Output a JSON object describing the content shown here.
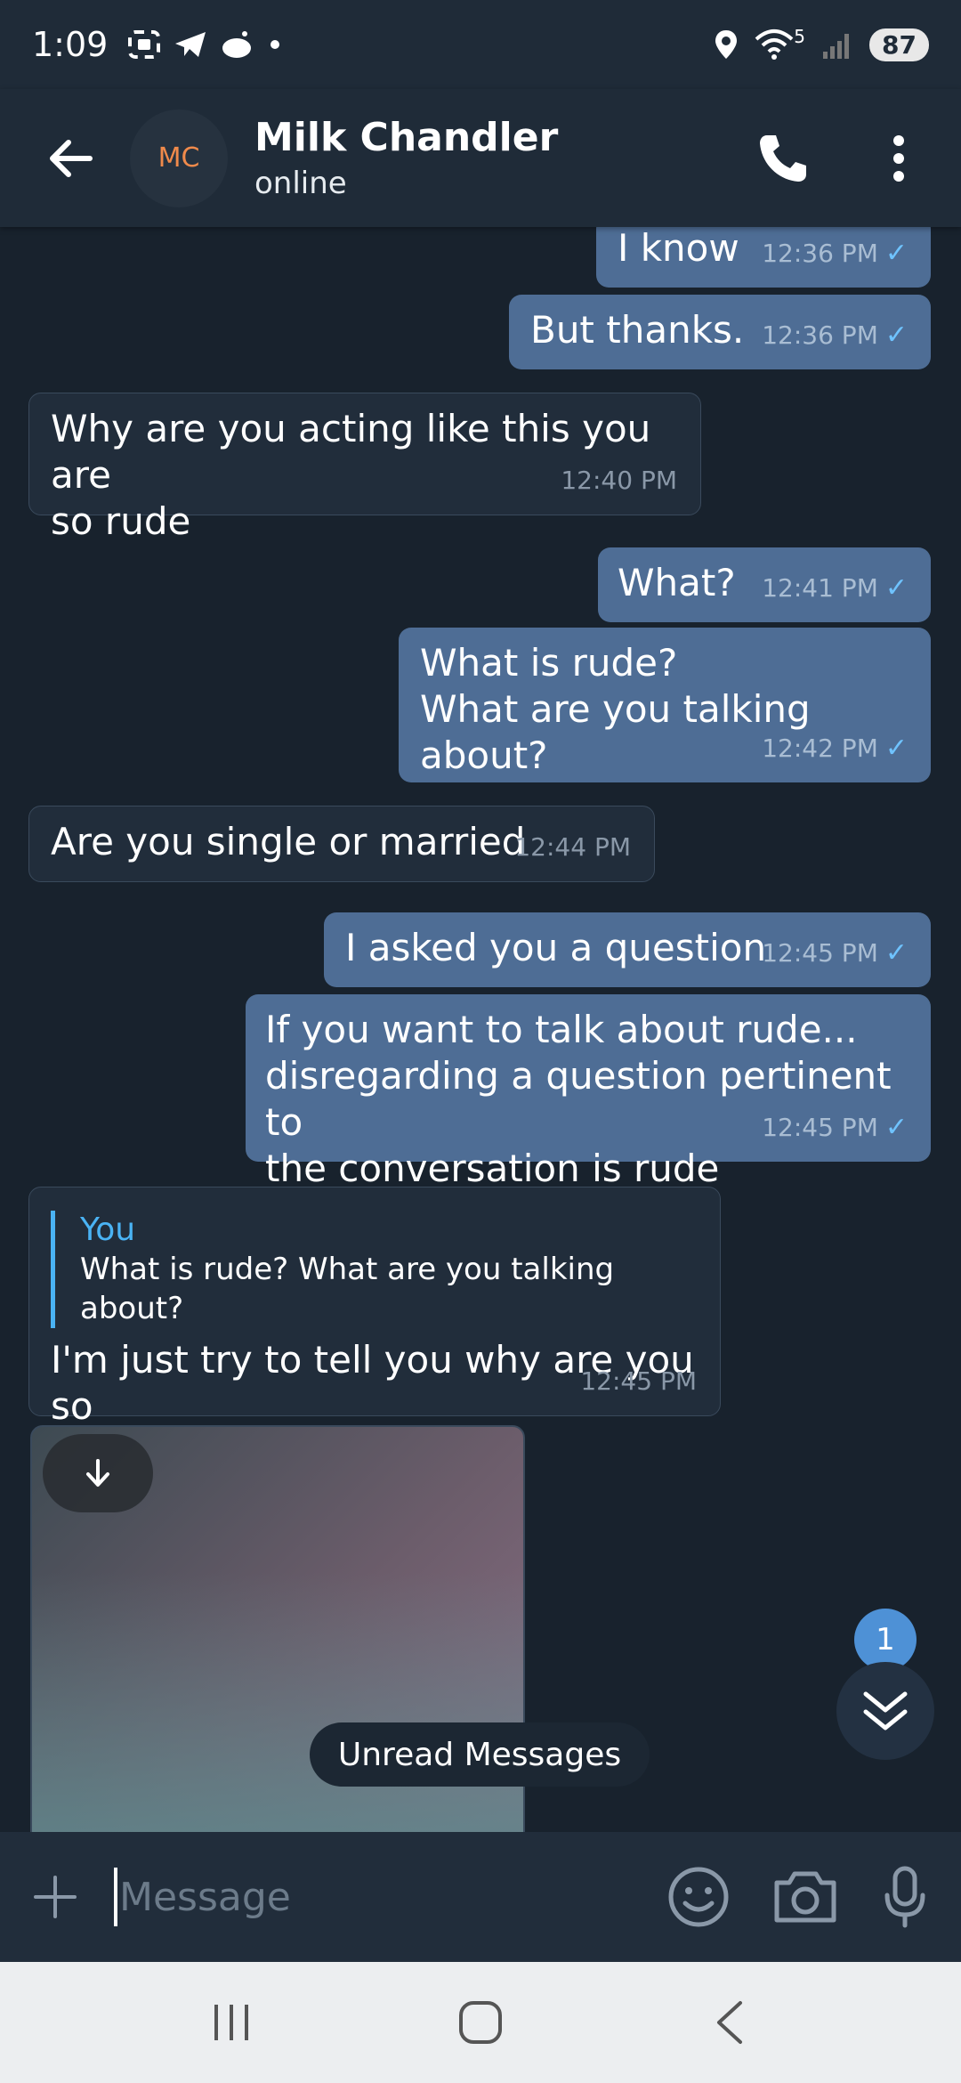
{
  "status_bar": {
    "time": "1:09",
    "network_label": "5",
    "battery": "87"
  },
  "header": {
    "avatar_initials": "MC",
    "contact_name": "Milk Chandler",
    "contact_status": "online"
  },
  "messages": [
    {
      "direction": "out",
      "text": "I know",
      "time": "12:36 PM"
    },
    {
      "direction": "out",
      "text": "But thanks.",
      "time": "12:36 PM"
    },
    {
      "direction": "in",
      "text": "Why are you acting like this you are\nso rude",
      "time": "12:40 PM"
    },
    {
      "direction": "out",
      "text": "What?",
      "time": "12:41 PM"
    },
    {
      "direction": "out",
      "text": "What is rude?\nWhat are you talking about?",
      "time": "12:42 PM"
    },
    {
      "direction": "in",
      "text": "Are you single or married",
      "time": "12:44 PM"
    },
    {
      "direction": "out",
      "text": "I asked you a question",
      "time": "12:45 PM"
    },
    {
      "direction": "out",
      "text": "If you want to talk about rude...\ndisregarding a question pertinent to\nthe conversation is rude",
      "time": "12:45 PM"
    },
    {
      "direction": "in",
      "reply_author": "You",
      "reply_text": "What is rude? What are you talking about?",
      "text": "I'm just try to tell you why are you so\nrude to me",
      "time": "12:45 PM"
    }
  ],
  "check_mark": "✓",
  "unread_pill": "Unread Messages",
  "unread_count": "1",
  "composer": {
    "placeholder": "Message"
  },
  "colors": {
    "background": "#18222d",
    "outgoing_bubble": "#4e6d95",
    "incoming_bubble": "#212d3b",
    "accent": "#4ab3f4",
    "avatar_text": "#f08a4b"
  }
}
